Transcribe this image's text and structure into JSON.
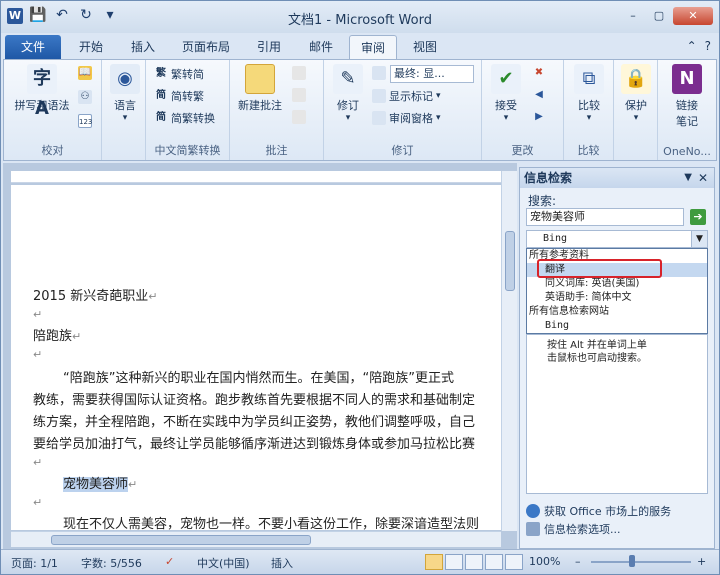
{
  "window": {
    "title": "文档1 - Microsoft Word",
    "app_icon": "W",
    "minimize": "–",
    "restore": "▢",
    "close": "✕"
  },
  "qat": {
    "save": "💾",
    "undo": "↶",
    "redo": "↻",
    "customize": "▾"
  },
  "tabs": [
    {
      "label": "文件",
      "kind": "file"
    },
    {
      "label": "开始"
    },
    {
      "label": "插入"
    },
    {
      "label": "页面布局"
    },
    {
      "label": "引用"
    },
    {
      "label": "邮件"
    },
    {
      "label": "审阅",
      "active": true
    },
    {
      "label": "视图"
    }
  ],
  "ribbon": {
    "proofing": {
      "group_label": "校对",
      "spelling": "拼写和语法"
    },
    "language": {
      "label": "语言"
    },
    "chinese_conversion": {
      "group_label": "中文简繁转换",
      "to_traditional": "繁转简",
      "to_simplified": "简转繁",
      "conversion": "简繁转换"
    },
    "comments": {
      "group_label": "批注",
      "new_comment": "新建批注"
    },
    "tracking": {
      "group_label": "修订",
      "track_changes": "修订",
      "display_combo": "最终: 显...",
      "show_markup": "显示标记",
      "reviewing_pane": "审阅窗格"
    },
    "changes": {
      "group_label": "更改",
      "accept": "接受"
    },
    "compare": {
      "group_label": "比较",
      "compare": "比较"
    },
    "protect": {
      "label": "保护"
    },
    "onenote": {
      "group_label": "OneNo...",
      "linked_notes_1": "链接",
      "linked_notes_2": "笔记"
    }
  },
  "document": {
    "lines": [
      "2015 新兴奇葩职业",
      "",
      "陪跑族",
      "",
      "“陪跑族”这种新兴的职业在国内悄然而生。在美国，“陪跑族”更正式",
      "教练，需要获得国际认证资格。跑步教练首先要根据不同人的需求和基础制定",
      "练方案，并全程陪跑，不断在实践中为学员纠正姿势，教他们调整呼吸，自己",
      "要给学员加油打气，最终让学员能够循序渐进达到锻炼身体或参加马拉松比赛",
      "",
      "宠物美容师",
      "",
      "现在不仅人需美容，宠物也一样。不要小看这份工作，除要深谙造型法则"
    ],
    "para_mark": "↵"
  },
  "research_pane": {
    "title": "信息检索",
    "search_label": "搜索:",
    "search_value": "宠物美容师",
    "source_value": "Bing",
    "dropdown_items": [
      {
        "label": "所有参考资料",
        "indent": 0
      },
      {
        "label": "翻译",
        "indent": 1,
        "selected": true
      },
      {
        "label": "同义词库: 英语(美国)",
        "indent": 1
      },
      {
        "label": "英语助手: 简体中文",
        "indent": 1
      },
      {
        "label": "所有信息检索网站",
        "indent": 0
      },
      {
        "label": "Bing",
        "indent": 1
      }
    ],
    "hint_line1": "按住 Alt 并在单词上单",
    "hint_line2": "击鼠标也可启动搜索。",
    "footer_link1": "获取 Office 市场上的服务",
    "footer_link2": "信息检索选项..."
  },
  "statusbar": {
    "page": "页面: 1/1",
    "words": "字数: 5/556",
    "language": "中文(中国)",
    "insert_mode": "插入",
    "zoom": "100%",
    "zoom_minus": "–",
    "zoom_plus": "+"
  }
}
